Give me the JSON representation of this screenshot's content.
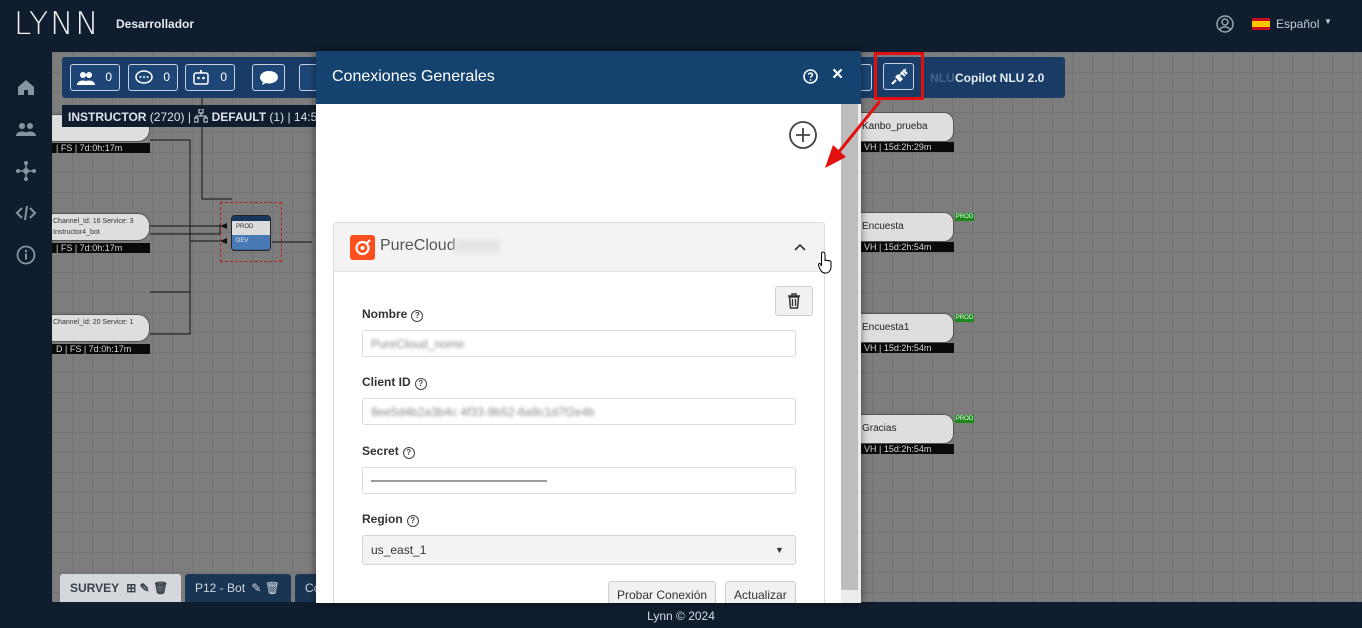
{
  "app": {
    "logo": "LYNN",
    "role": "Desarrollador",
    "language": "Español"
  },
  "sidebar": {
    "items": [
      "home-icon",
      "users-icon",
      "flows-icon",
      "code-icon",
      "info-icon"
    ]
  },
  "toolbar": {
    "counts": [
      "0",
      "0",
      "0"
    ],
    "nlu_label": "NLU",
    "copilot_label": "Copilot NLU 2.0"
  },
  "info_strip": {
    "instructor": "INSTRUCTOR",
    "instructor_count": "(2720)",
    "default": "DEFAULT",
    "default_count": "(1)",
    "time": "14:5"
  },
  "canvas": {
    "left_nodes": [
      {
        "sub": "| FS | 7d:0h:17m"
      },
      {
        "text": "Channel_Id: 16 Service: 3",
        "text2": "Instructor4_bot",
        "sub": "| FS | 7d:0h:17m"
      },
      {
        "text": "Channel_Id: 20 Service: 1",
        "sub": "D | FS | 7d:0h:17m"
      }
    ],
    "route": {
      "prod": "PROD",
      "dev": "DEV"
    },
    "right_nodes": [
      {
        "title": "Kanbo_prueba",
        "sub": "VH | 15d:2h:29m",
        "badge": ""
      },
      {
        "title": "Encuesta",
        "sub": "VH | 15d:2h:54m",
        "badge": "PROD"
      },
      {
        "title": "Encuesta1",
        "sub": "VH | 15d:2h:54m",
        "badge": "PROD"
      },
      {
        "title": "Gracias",
        "sub": "VH | 15d:2h:54m",
        "badge": "PROD"
      }
    ]
  },
  "tabs": [
    "SURVEY",
    "P12 - Bot",
    "Co"
  ],
  "footer": "Lynn © 2024",
  "modal": {
    "title": "Conexiones Generales",
    "connection": {
      "name": "PureCloud"
    },
    "fields": {
      "nombre": {
        "label": "Nombre",
        "value": "PureCloud_nome"
      },
      "client_id": {
        "label": "Client ID",
        "value": "8ee5d4b2a3b4c 4f33-9b52-6a9c1d7f2e4b"
      },
      "secret": {
        "label": "Secret"
      },
      "region": {
        "label": "Region",
        "value": "us_east_1"
      }
    },
    "buttons": {
      "test": "Probar Conexión",
      "update": "Actualizar"
    }
  },
  "colors": {
    "header": "#144370",
    "topbar": "#0f1d2e",
    "highlight": "#e31010",
    "purecloud": "#ff4f1f"
  }
}
